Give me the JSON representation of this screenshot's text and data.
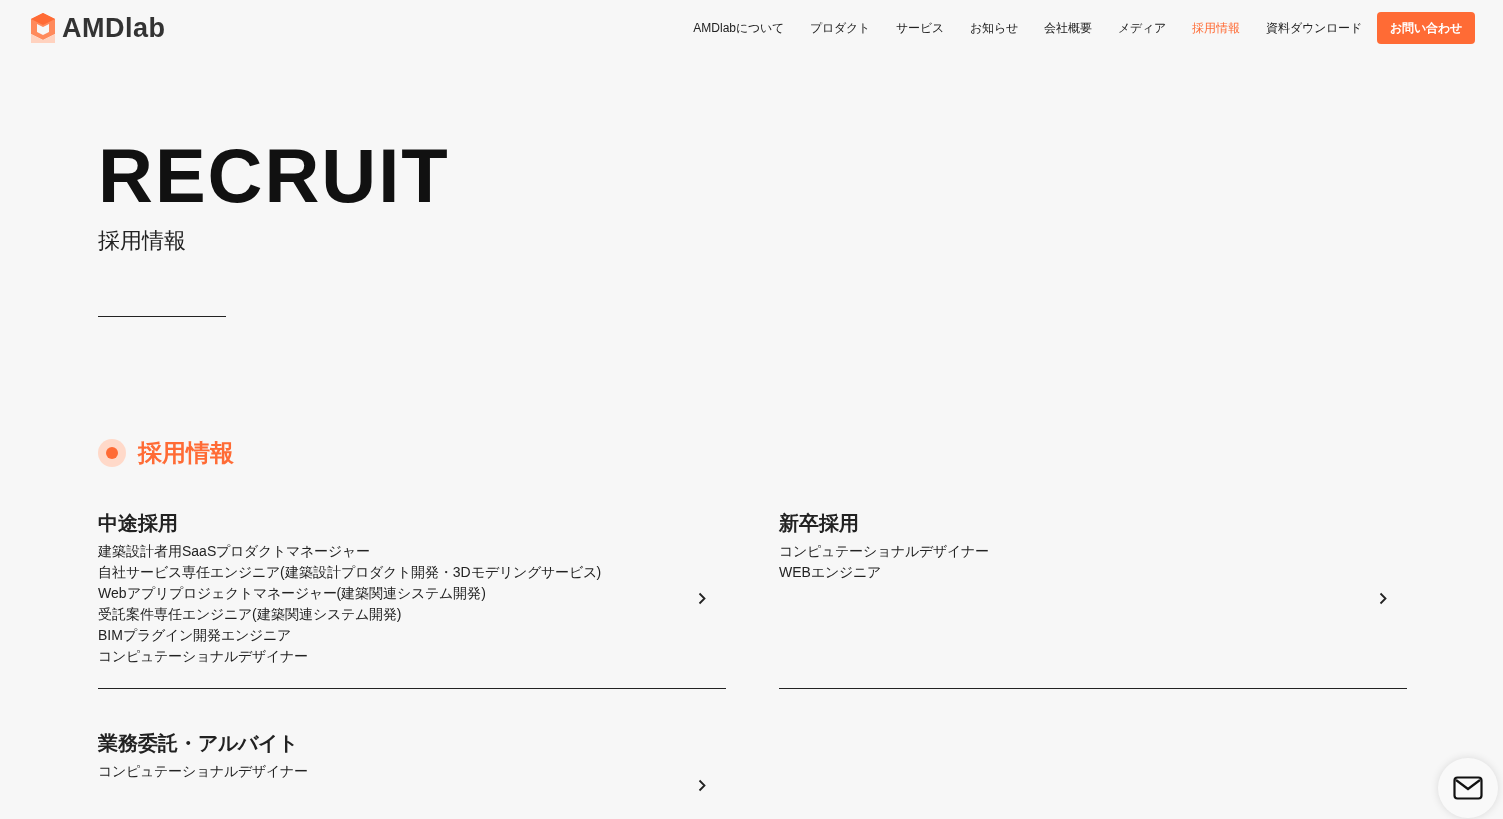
{
  "header": {
    "logo": "AMDlab",
    "nav": [
      {
        "label": "AMDlabについて",
        "selected": false
      },
      {
        "label": "プロダクト",
        "selected": false
      },
      {
        "label": "サービス",
        "selected": false
      },
      {
        "label": "お知らせ",
        "selected": false
      },
      {
        "label": "会社概要",
        "selected": false
      },
      {
        "label": "メディア",
        "selected": false
      },
      {
        "label": "採用情報",
        "selected": true
      },
      {
        "label": "資料ダウンロード",
        "selected": false
      }
    ],
    "contact_button": "お問い合わせ"
  },
  "hero": {
    "title": "RECRUIT",
    "subtitle": "採用情報"
  },
  "section": {
    "heading": "採用情報",
    "cards": [
      {
        "title": "中途採用",
        "items": [
          "建築設計者用SaaSプロダクトマネージャー",
          "自社サービス専任エンジニア(建築設計プロダクト開発・3Dモデリングサービス)",
          "Webアプリプロジェクトマネージャー(建築関連システム開発)",
          "受託案件専任エンジニア(建築関連システム開発)",
          "BIMプラグイン開発エンジニア",
          "コンピュテーショナルデザイナー"
        ]
      },
      {
        "title": "新卒採用",
        "items": [
          "コンピュテーショナルデザイナー",
          "WEBエンジニア"
        ]
      },
      {
        "title": "業務委託・アルバイト",
        "items": [
          "コンピュテーショナルデザイナー"
        ]
      }
    ]
  }
}
